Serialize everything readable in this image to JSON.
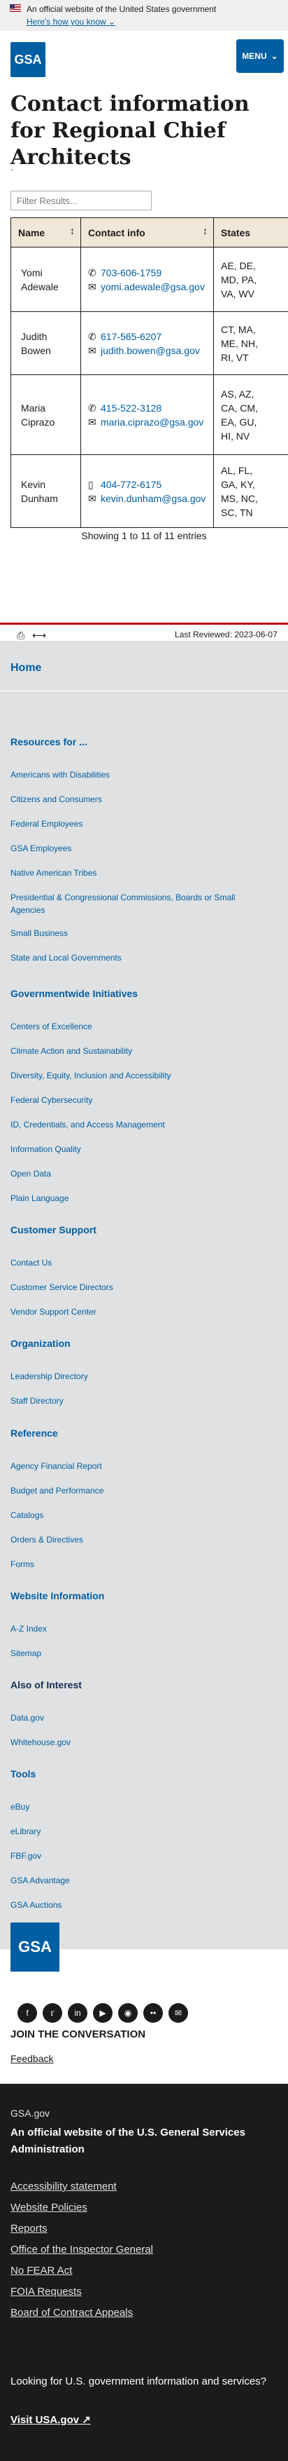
{
  "banner": {
    "text": "An official website of the United States government",
    "toggle": "Here's how you know"
  },
  "header": {
    "logo": "GSA",
    "menu": "MENU"
  },
  "page": {
    "title": "Contact information for Regional Chief Architects",
    "dot": "."
  },
  "filter": {
    "placeholder": "Filter Results..."
  },
  "table": {
    "headers": [
      "Name",
      "Contact info",
      "States"
    ],
    "rows": [
      {
        "name": "Yomi Adewale",
        "phone": "703-606-1759",
        "email": "yomi.adewale@gsa.gov",
        "states": [
          "AE, DE,",
          "MD, PA,",
          "VA, WV"
        ]
      },
      {
        "name": "Judith Bowen",
        "phone": "617-565-6207",
        "email": "judith.bowen@gsa.gov",
        "states": [
          "CT, MA,",
          "ME, NH,",
          "RI, VT"
        ]
      },
      {
        "name": "Maria Ciprazo",
        "phone": "415-522-3128",
        "email": "maria.ciprazo@gsa.gov",
        "states": [
          "AS, AZ,",
          "CA, CM,",
          "EA, GU,",
          "HI, NV"
        ]
      },
      {
        "name": "Kevin Dunham",
        "phone": "404-772-6175",
        "email": "kevin.dunham@gsa.gov",
        "states": [
          "AL, FL,",
          "GA, KY,",
          "MS, NC,",
          "SC, TN"
        ]
      }
    ]
  },
  "showing": "Showing 1 to 11 of 11 entries",
  "last_reviewed": "Last Reviewed: 2023-06-07",
  "footer": {
    "home": "Home",
    "resources_heading": "Resources for ...",
    "resources": [
      "Americans with Disabilities",
      "Citizens and Consumers",
      "Federal Employees",
      "GSA Employees",
      "Native American Tribes",
      "Presidential & Congressional Commissions, Boards or Small Agencies",
      "Small Business",
      "State and Local Governments"
    ],
    "gov_heading": "Governmentwide Initiatives",
    "gov": [
      "Centers of Excellence",
      "Climate Action and Sustainability",
      "Diversity, Equity, Inclusion and Accessibility",
      "Federal Cybersecurity",
      "ID, Credentials, and Access Management",
      "Information Quality",
      "Open Data",
      "Plain Language"
    ],
    "cs_heading": "Customer Support",
    "cs": [
      "Contact Us",
      "Customer Service Directors",
      "Vendor Support Center"
    ],
    "org_heading": "Organization",
    "org": [
      "Leadership Directory",
      "Staff Directory"
    ],
    "ref_heading": "Reference",
    "ref": [
      "Agency Financial Report",
      "Budget and Performance",
      "Catalogs",
      "Orders & Directives",
      "Forms"
    ],
    "wi_heading": "Website Information",
    "wi": [
      "A-Z Index",
      "Sitemap"
    ],
    "aoi_heading": "Also of Interest",
    "aoi": [
      "Data.gov",
      "Whitehouse.gov"
    ],
    "tools_heading": "Tools",
    "tools": [
      "eBuy",
      "eLibrary",
      "FBF.gov",
      "GSA Advantage",
      "GSA Auctions"
    ]
  },
  "social": {
    "logo": "GSA",
    "join": "JOIN THE CONVERSATION",
    "feedback": "Feedback",
    "icons": [
      "facebook-icon",
      "twitter-icon",
      "linkedin-icon",
      "youtube-icon",
      "instagram-icon",
      "flickr-icon",
      "email-icon"
    ]
  },
  "identifier": {
    "domain": "GSA.gov",
    "official": "An official website of the U.S. General Services Administration",
    "links": [
      "Accessibility statement",
      "Website Policies",
      "Reports",
      "Office of the Inspector General",
      "No FEAR Act",
      "FOIA Requests",
      "Board of Contract Appeals"
    ],
    "looking": "Looking for U.S. government information and services?",
    "visit": "Visit USA.gov"
  }
}
